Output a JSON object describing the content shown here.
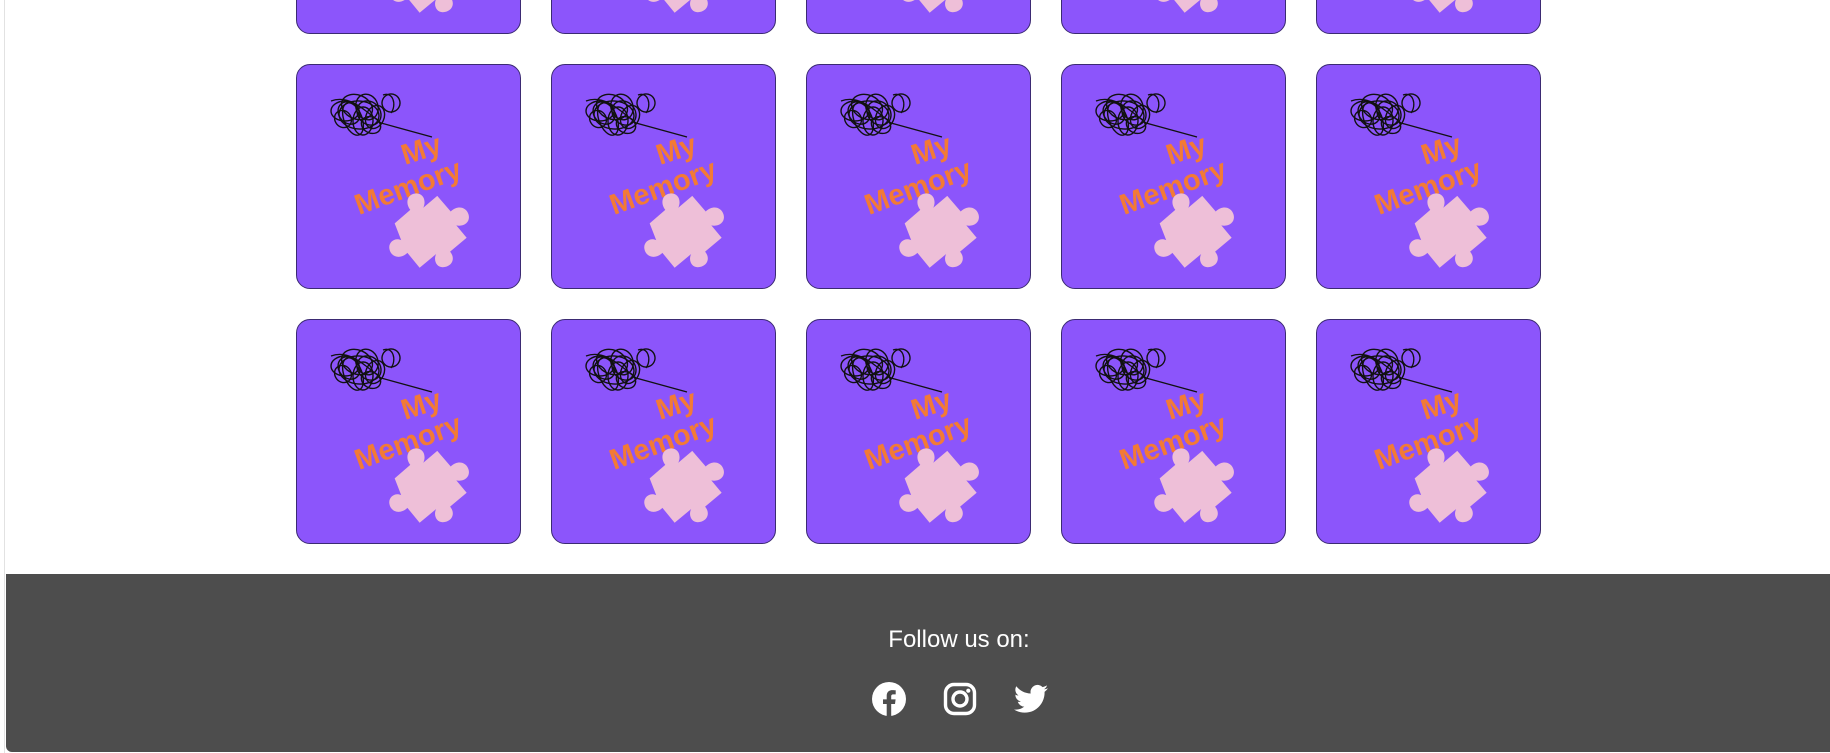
{
  "colors": {
    "card_background": "#8c55fb",
    "logo_text": "#f37a35",
    "puzzle_piece": "#eebfd8",
    "footer_background": "#4d4d4d",
    "footer_text": "#ffffff"
  },
  "card_logo_text": {
    "line1": "My",
    "line2": "Memory"
  },
  "footer": {
    "follow_text": "Follow us on:",
    "socials": [
      {
        "name": "facebook",
        "icon": "facebook-icon"
      },
      {
        "name": "instagram",
        "icon": "instagram-icon"
      },
      {
        "name": "twitter",
        "icon": "twitter-icon"
      }
    ]
  }
}
